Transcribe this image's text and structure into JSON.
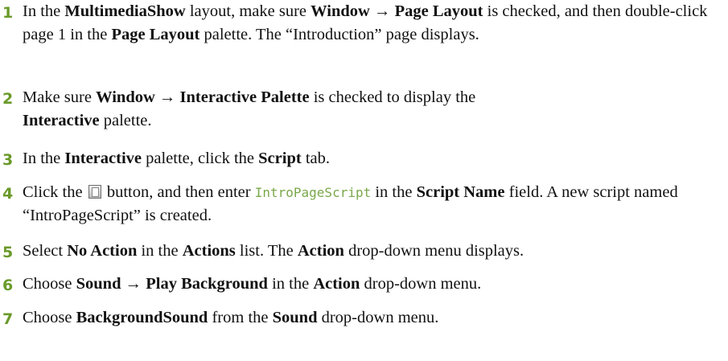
{
  "steps": [
    {
      "number": "1",
      "t1": "In the ",
      "b1": "MultimediaShow",
      "t2": " layout, make sure ",
      "b2": "Window → Page Layout",
      "t3": " is checked, and then double-click page 1 in the ",
      "b3": "Page Layout",
      "t4": " palette. The “Introduction” page displays."
    },
    {
      "number": "2",
      "t1": "Make sure ",
      "b1": "Window → Interactive Palette",
      "t2": " is checked to display the ",
      "b2": "Interactive",
      "t3": " palette."
    },
    {
      "number": "3",
      "t1": "In the ",
      "b1": "Interactive",
      "t2": " palette, click the ",
      "b2": "Script",
      "t3": " tab."
    },
    {
      "number": "4",
      "t1": "Click the ",
      "t2": " button, and then enter ",
      "code": "IntroPageScript",
      "t3": " in the ",
      "b1": "Script Name",
      "t4": " field. A new script named “IntroPageScript” is created."
    },
    {
      "number": "5",
      "t1": "Select ",
      "b1": "No Action",
      "t2": " in the ",
      "b2": "Actions",
      "t3": " list. The ",
      "b3": "Action",
      "t4": " drop-down menu displays."
    },
    {
      "number": "6",
      "t1": "Choose ",
      "b1": "Sound → Play Background",
      "t2": " in the ",
      "b2": "Action",
      "t3": " drop-down menu."
    },
    {
      "number": "7",
      "t1": "Choose ",
      "b1": "BackgroundSound",
      "t2": " from the ",
      "b2": "Sound",
      "t3": " drop-down menu."
    }
  ],
  "icons": {
    "new_script_button": "new-document-icon"
  }
}
